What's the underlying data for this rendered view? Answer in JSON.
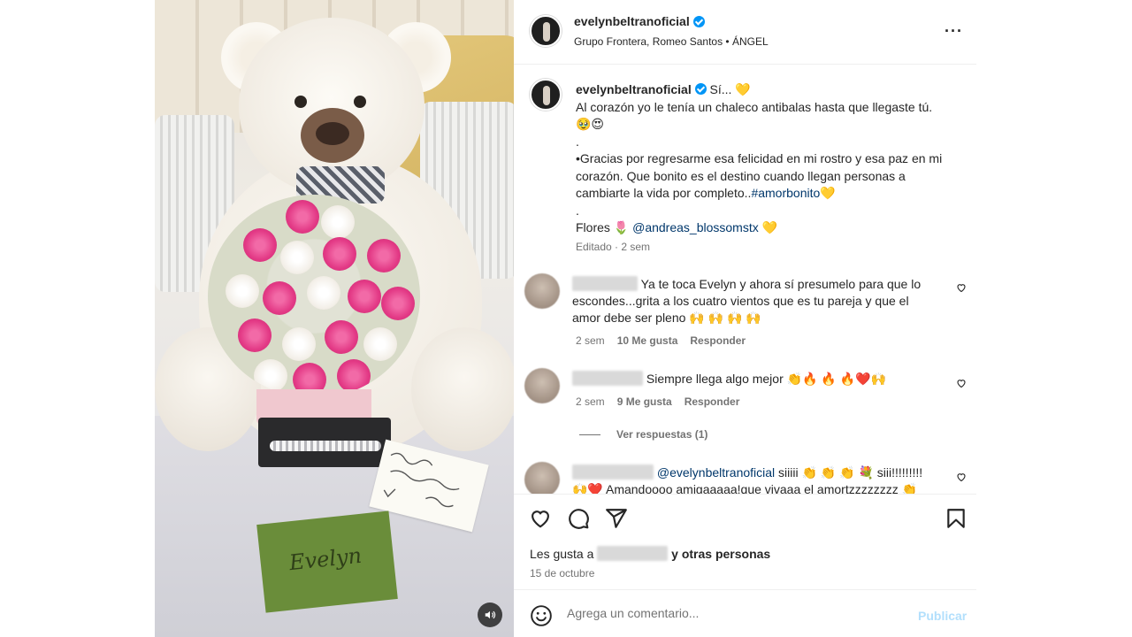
{
  "post": {
    "username": "evelynbeltranoficial",
    "song": "Grupo Frontera, Romeo Santos • ÁNGEL",
    "caption": {
      "opening": "Sí... 💛",
      "line1": "Al corazón yo le tenía un chaleco antibalas hasta que llegaste tú. 🥹😍",
      "dot1": ".",
      "line2": "•Gracias por regresarme esa felicidad en mi rostro y esa paz en mi corazón. Que bonito es el destino cuando llegan personas a cambiarte la vida por completo..",
      "hashtag": "#amorbonito",
      "hashtag_emoji": "💛",
      "dot2": ".",
      "flowers_label": "Flores 🌷",
      "flowers_mention": "@andreas_blossomstx",
      "flowers_emoji": "💛",
      "meta": "Editado · 2 sem"
    },
    "card_text": "Evelyn"
  },
  "comments": [
    {
      "text": "Ya te toca Evelyn y ahora sí presumelo para que lo escondes...grita a los cuatro vientos que es tu pareja y que el amor debe ser pleno 🙌 🙌 🙌 🙌",
      "time": "2 sem",
      "likes": "10 Me gusta",
      "reply": "Responder"
    },
    {
      "text": "Siempre llega algo mejor 👏🔥 🔥 🔥❤️🙌",
      "time": "2 sem",
      "likes": "9 Me gusta",
      "reply": "Responder",
      "view_replies": "Ver respuestas (1)"
    },
    {
      "mention": "@evelynbeltranoficial",
      "text": " siiiii 👏 👏 👏 💐 siii!!!!!!!!!",
      "text2": "🙌❤️ Amandoooo amigaaaaa!que vivaaa el amortzzzzzzzz 👏"
    }
  ],
  "footer": {
    "likes_prefix": "Les gusta a",
    "likes_suffix": "y otras personas",
    "date": "15 de octubre",
    "comment_placeholder": "Agrega un comentario...",
    "publish": "Publicar"
  },
  "colors": {
    "verified": "#0095f6",
    "link": "#00376b",
    "publish_disabled": "#b2dffc"
  },
  "icons": [
    "verified-badge-icon",
    "more-options-icon",
    "heart-icon",
    "comment-icon",
    "share-icon",
    "bookmark-icon",
    "emoji-icon",
    "audio-icon"
  ]
}
